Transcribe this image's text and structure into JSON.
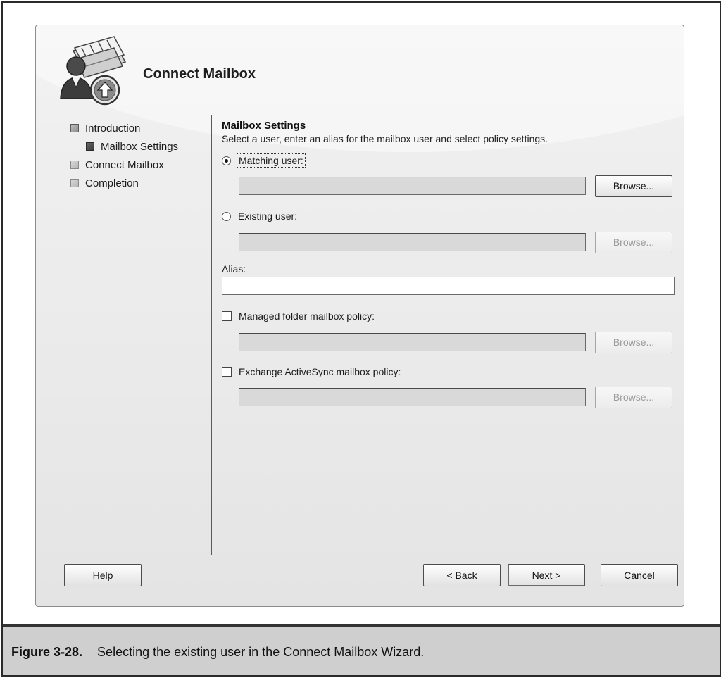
{
  "window": {
    "title": "Connect Mailbox"
  },
  "nav": {
    "items": [
      {
        "label": "Introduction",
        "state": "done",
        "indent": false
      },
      {
        "label": "Mailbox Settings",
        "state": "current",
        "indent": true
      },
      {
        "label": "Connect Mailbox",
        "state": "pending",
        "indent": false
      },
      {
        "label": "Completion",
        "state": "pending",
        "indent": false
      }
    ]
  },
  "content": {
    "title": "Mailbox Settings",
    "description": "Select a user, enter an alias for the mailbox user and select policy settings.",
    "matching_user": {
      "label": "Matching user:",
      "selected": true,
      "value": "",
      "browse_label": "Browse...",
      "browse_enabled": true
    },
    "existing_user": {
      "label": "Existing user:",
      "selected": false,
      "value": "",
      "browse_label": "Browse...",
      "browse_enabled": false
    },
    "alias": {
      "label": "Alias:",
      "value": ""
    },
    "managed_folder_policy": {
      "label": "Managed folder mailbox policy:",
      "checked": false,
      "value": "",
      "browse_label": "Browse...",
      "browse_enabled": false
    },
    "activesync_policy": {
      "label": "Exchange ActiveSync mailbox policy:",
      "checked": false,
      "value": "",
      "browse_label": "Browse...",
      "browse_enabled": false
    }
  },
  "footer": {
    "help_label": "Help",
    "back_label": "< Back",
    "next_label": "Next >",
    "cancel_label": "Cancel"
  },
  "caption": {
    "label": "Figure 3-28.",
    "text": "Selecting the existing user in the Connect Mailbox Wizard."
  },
  "icons": {
    "wizard_icon": "mailbox-user-upload-icon"
  }
}
